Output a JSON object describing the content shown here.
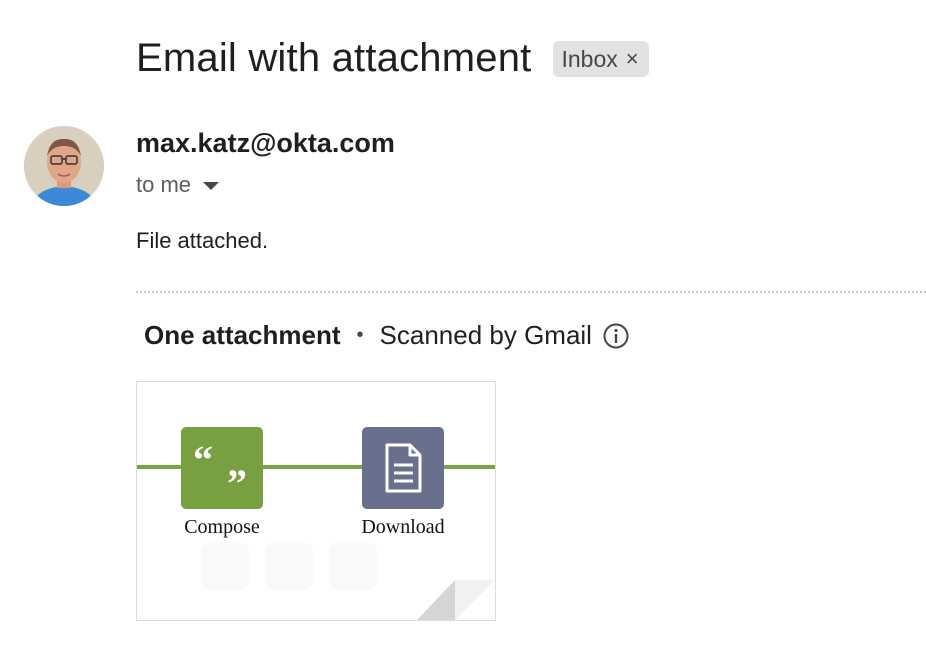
{
  "email": {
    "subject": "Email with attachment",
    "label": "Inbox",
    "label_remove": "×",
    "sender": "max.katz@okta.com",
    "recipient": "to me",
    "body": "File attached."
  },
  "attachments": {
    "count_label": "One attachment",
    "separator": "•",
    "scan_label": "Scanned by Gmail",
    "preview": {
      "compose_label": "Compose",
      "download_label": "Download",
      "compose_glyph": "“ ”",
      "colors": {
        "line": "#7aa541",
        "compose": "#78a040",
        "download": "#68708e"
      }
    }
  },
  "icons": {
    "info": "info-icon",
    "caret": "chevron-down-icon",
    "document": "document-icon",
    "quote": "quote-icon"
  }
}
